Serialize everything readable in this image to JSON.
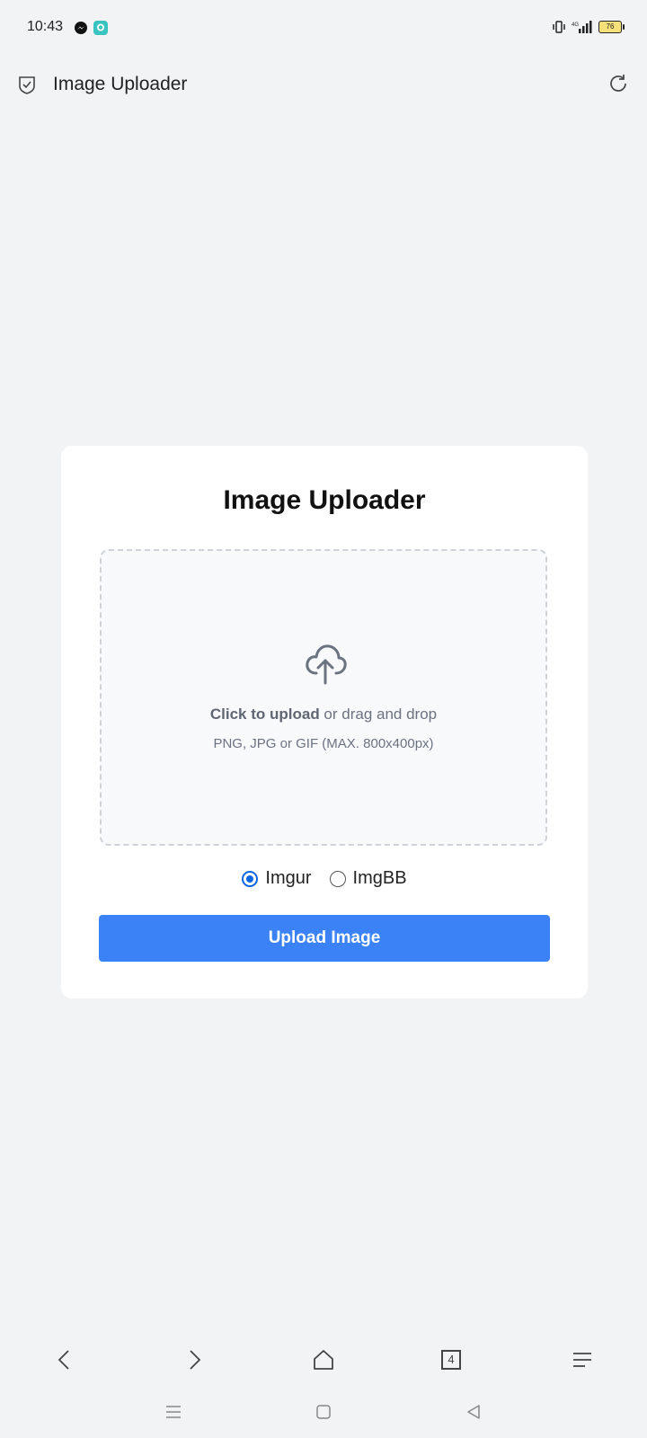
{
  "status_bar": {
    "time": "10:43",
    "battery": "76",
    "icons": [
      "messenger-icon",
      "chat-icon",
      "vibrate-icon",
      "signal-icon",
      "battery-icon"
    ]
  },
  "app_bar": {
    "title": "Image Uploader",
    "icons": [
      "shield-icon",
      "refresh-icon"
    ]
  },
  "card": {
    "title": "Image Uploader",
    "dropzone": {
      "icon": "cloud-upload-icon",
      "click_text": "Click to upload",
      "drag_text": " or drag and drop",
      "hint": "PNG, JPG or GIF (MAX. 800x400px)"
    },
    "hosts": [
      {
        "label": "Imgur",
        "selected": true
      },
      {
        "label": "ImgBB",
        "selected": false
      }
    ],
    "upload_label": "Upload Image"
  },
  "browser_nav": {
    "tab_count": "4",
    "icons": [
      "back-icon",
      "forward-icon",
      "home-icon",
      "tabs-icon",
      "menu-icon"
    ]
  },
  "system_nav": {
    "icons": [
      "recents-icon",
      "home-icon",
      "back-icon"
    ]
  },
  "colors": {
    "accent": "#3b82f6",
    "radio_selected": "#0b66e4",
    "background": "#f2f3f5"
  }
}
